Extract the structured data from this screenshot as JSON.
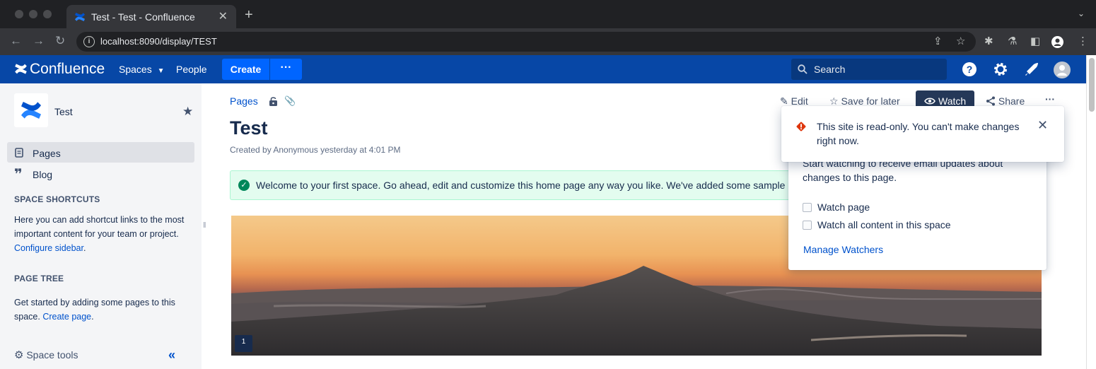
{
  "browser": {
    "tab_title": "Test - Test - Confluence",
    "tab_close": "✕",
    "new_tab": "+",
    "tab_menu": "⌄",
    "url": "localhost:8090/display/TEST"
  },
  "header": {
    "logo_text": "Confluence",
    "spaces_label": "Spaces",
    "people_label": "People",
    "create_label": "Create",
    "more_label": "···",
    "search_placeholder": "Search"
  },
  "sidebar": {
    "space_name": "Test",
    "items": [
      {
        "label": "Pages"
      },
      {
        "label": "Blog"
      }
    ],
    "shortcuts_heading": "SPACE SHORTCUTS",
    "shortcuts_text": "Here you can add shortcut links to the most important content for your team or project.",
    "shortcuts_link": "Configure sidebar",
    "tree_heading": "PAGE TREE",
    "tree_text": "Get started by adding some pages to this space.",
    "tree_link": "Create page",
    "space_tools": "Space tools",
    "collapse": "«"
  },
  "content": {
    "breadcrumb": "Pages",
    "title": "Test",
    "byline": "Created by Anonymous yesterday at 4:01 PM",
    "info_text": "Welcome to your first space. Go ahead, edit and customize this home page any way you like. We've added some sample content to get you started.",
    "comment_count": "1"
  },
  "actions": {
    "edit": "Edit",
    "save_for_later": "Save for later",
    "watch": "Watch",
    "share": "Share",
    "more": "···"
  },
  "watch_menu": {
    "description": "Start watching to receive email updates about changes to this page.",
    "watch_page": "Watch page",
    "watch_all": "Watch all content in this space",
    "manage": "Manage Watchers"
  },
  "flag": {
    "message": "This site is read-only. You can't make changes right now.",
    "close": "✕"
  },
  "colors": {
    "header_bg": "#0747a6",
    "accent": "#0065ff",
    "link": "#0052cc",
    "success": "#00875a",
    "error": "#de350b"
  }
}
